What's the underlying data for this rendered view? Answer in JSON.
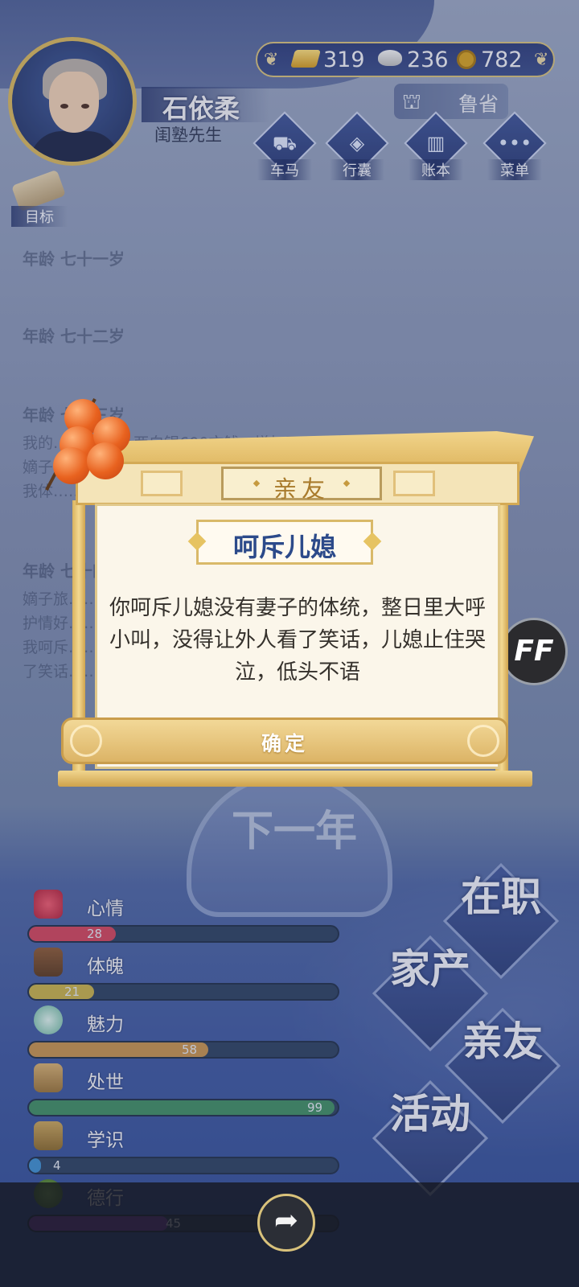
{
  "player": {
    "name": "石依柔",
    "title": "闺塾先生"
  },
  "currency": {
    "gold": "319",
    "silver": "236",
    "coins": "782"
  },
  "location": {
    "province": "鲁省"
  },
  "nav": [
    {
      "label": "车马",
      "icon": "carriage-icon"
    },
    {
      "label": "行囊",
      "icon": "bag-icon"
    },
    {
      "label": "账本",
      "icon": "ledger-icon"
    },
    {
      "label": "菜单",
      "icon": "menu-icon"
    }
  ],
  "goal": {
    "label": "目标"
  },
  "log": {
    "ages": [
      "年龄 七十一岁",
      "年龄 七十二岁",
      "年龄 七十三岁",
      "年龄 七十四岁"
    ],
    "lines_age73": [
      "我的……到了21两白银600文钱，增加了……成",
      "嫡子……",
      "我体……"
    ],
    "lines_age74": [
      "嫡子旅……，为",
      "护情好……",
      "我呵斥……",
      "了笑话……"
    ]
  },
  "dialog": {
    "category": "亲友",
    "event_title": "呵斥儿媳",
    "event_text": "你呵斥儿媳没有妻子的体统，整日里大呼小叫，没得让外人看了笑话，儿媳止住哭泣，低头不语",
    "confirm_label": "确定"
  },
  "next_year": {
    "label": "下一年"
  },
  "stats": [
    {
      "label": "心情",
      "value": 28,
      "max": 100,
      "color": "#d2455c",
      "icon": "flower-icon"
    },
    {
      "label": "体魄",
      "value": 21,
      "max": 100,
      "color": "#c8b14a",
      "icon": "dumbbell-icon"
    },
    {
      "label": "魅力",
      "value": 58,
      "max": 100,
      "color": "#c7924e",
      "icon": "mirror-icon"
    },
    {
      "label": "处世",
      "value": 99,
      "max": 100,
      "color": "#3f8e63",
      "icon": "scroll-icon"
    },
    {
      "label": "学识",
      "value": 4,
      "max": 100,
      "color": "#3e8fd0",
      "icon": "books-icon"
    },
    {
      "label": "德行",
      "value": 45,
      "max": 100,
      "color": "#7a3fb0",
      "icon": "virtue-icon"
    }
  ],
  "side_buttons": {
    "job": "在职",
    "property": "家产",
    "relatives": "亲友",
    "activity": "活动"
  },
  "ff_label": "FF",
  "share_icon": "share-icon"
}
